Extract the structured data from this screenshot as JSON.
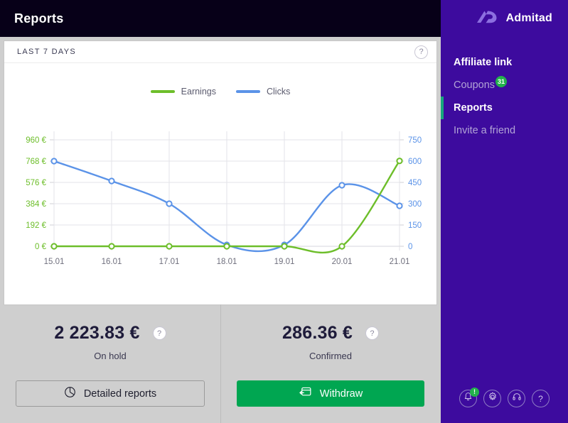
{
  "header": {
    "title": "Reports"
  },
  "card": {
    "title": "LAST 7 DAYS",
    "help_icon": "question-mark-icon",
    "help_label": "?"
  },
  "chart_data": {
    "type": "line",
    "title": "LAST 7 DAYS",
    "x": [
      "15.01",
      "16.01",
      "17.01",
      "18.01",
      "19.01",
      "20.01",
      "21.01"
    ],
    "series": [
      {
        "name": "Earnings",
        "color": "#6dbe2a",
        "axis": "left",
        "unit": "€",
        "values": [
          0,
          0,
          0,
          0,
          0,
          0,
          770
        ]
      },
      {
        "name": "Clicks",
        "color": "#5b93e8",
        "axis": "right",
        "unit": "",
        "values": [
          600,
          460,
          300,
          10,
          10,
          430,
          285
        ]
      }
    ],
    "y_left": {
      "label": "Earnings",
      "ticks": [
        "0 €",
        "192 €",
        "384 €",
        "576 €",
        "768 €",
        "960 €"
      ],
      "tick_values": [
        0,
        192,
        384,
        576,
        768,
        960
      ],
      "ylim": [
        0,
        960
      ],
      "color": "#6dbe2a"
    },
    "y_right": {
      "label": "Clicks",
      "ticks": [
        "0",
        "150",
        "300",
        "450",
        "600",
        "750"
      ],
      "tick_values": [
        0,
        150,
        300,
        450,
        600,
        750
      ],
      "ylim": [
        0,
        750
      ],
      "color": "#5b93e8"
    },
    "xlabel": "",
    "grid": true,
    "legend_position": "top-center",
    "legend": [
      "Earnings",
      "Clicks"
    ]
  },
  "stats": [
    {
      "amount": "2 223.83 €",
      "label": "On hold",
      "help_label": "?",
      "button": {
        "label": "Detailed reports",
        "icon": "pie-chart-icon",
        "style": "outline"
      }
    },
    {
      "amount": "286.36 €",
      "label": "Confirmed",
      "help_label": "?",
      "button": {
        "label": "Withdraw",
        "icon": "withdraw-card-icon",
        "style": "primary"
      }
    }
  ],
  "sidebar": {
    "brand": {
      "name": "Admitad",
      "logo_icon": "admitad-ad-logo-icon"
    },
    "items": [
      {
        "label": "Affiliate link",
        "active": true,
        "selected": false,
        "badge": null
      },
      {
        "label": "Coupons",
        "active": false,
        "selected": false,
        "badge": "31"
      },
      {
        "label": "Reports",
        "active": true,
        "selected": true,
        "badge": null
      },
      {
        "label": "Invite a friend",
        "active": false,
        "selected": false,
        "badge": null
      }
    ],
    "footer_icons": [
      {
        "name": "bell-icon",
        "badge": "!"
      },
      {
        "name": "gear-icon",
        "badge": null
      },
      {
        "name": "support-headset-icon",
        "badge": null
      },
      {
        "name": "question-mark-icon",
        "badge": null,
        "glyph": "?"
      }
    ]
  },
  "colors": {
    "sidebar_bg": "#3d0b9e",
    "topbar_bg": "#070018",
    "accent_green": "#00a651",
    "earnings_green": "#6dbe2a",
    "clicks_blue": "#5b93e8",
    "badge_green": "#23b14c",
    "active_bar": "#17a77d"
  }
}
